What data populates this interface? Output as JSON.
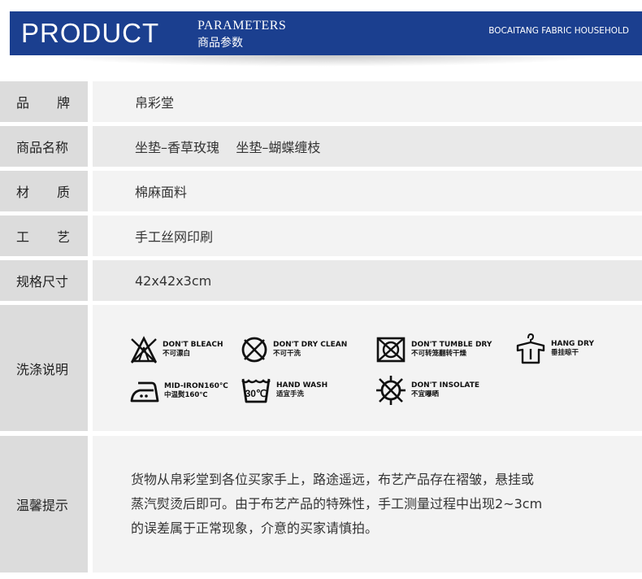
{
  "header": {
    "title": "PRODUCT",
    "subtitle_en": "PARAMETERS",
    "subtitle_cn": "商品参数",
    "brand": "BOCAITANG FABRIC HOUSEHOLD",
    "accent_color": "#1b3f8f"
  },
  "rows": {
    "brand": {
      "label_a": "品",
      "label_b": "牌",
      "value": "帛彩堂"
    },
    "name": {
      "label": "商品名称",
      "value": "坐垫–香草玫瑰    坐垫–蝴蝶缠枝"
    },
    "material": {
      "label_a": "材",
      "label_b": "质",
      "value": "棉麻面料"
    },
    "craft": {
      "label_a": "工",
      "label_b": "艺",
      "value": "手工丝网印刷"
    },
    "size": {
      "label": "规格尺寸",
      "value": "42x42x3cm"
    },
    "wash": {
      "label": "洗涤说明"
    },
    "notice": {
      "label": "温馨提示",
      "lines": [
        "货物从帛彩堂到各位买家手上，路途遥远，布艺产品存在褶皱，悬挂或",
        "蒸汽熨烫后即可。由于布艺产品的特殊性，手工测量过程中出现2~3cm",
        "的误差属于正常现象，介意的买家请慎拍。"
      ]
    }
  },
  "care": {
    "no_bleach": {
      "en": "DON'T BLEACH",
      "cn": "不可漂白",
      "icon": "no-bleach-icon"
    },
    "no_dry_clean": {
      "en": "DON'T DRY CLEAN",
      "cn": "不可干洗",
      "icon": "no-dry-clean-icon"
    },
    "no_tumble_dry": {
      "en": "DON'T TUMBLE DRY",
      "cn": "不可转笼翻转干燥",
      "icon": "no-tumble-dry-icon"
    },
    "hang_dry": {
      "en": "HANG DRY",
      "cn": "垂挂晾干",
      "icon": "hang-dry-icon"
    },
    "mid_iron": {
      "en": "MID-IRON160℃",
      "cn": "中温熨160℃",
      "icon": "iron-icon"
    },
    "hand_wash": {
      "en": "HAND WASH",
      "cn": "适宜手洗",
      "icon": "hand-wash-icon",
      "temp": "30℃"
    },
    "no_insolate": {
      "en": "DON'T INSOLATE",
      "cn": "不宜曝晒",
      "icon": "no-sun-icon"
    }
  }
}
